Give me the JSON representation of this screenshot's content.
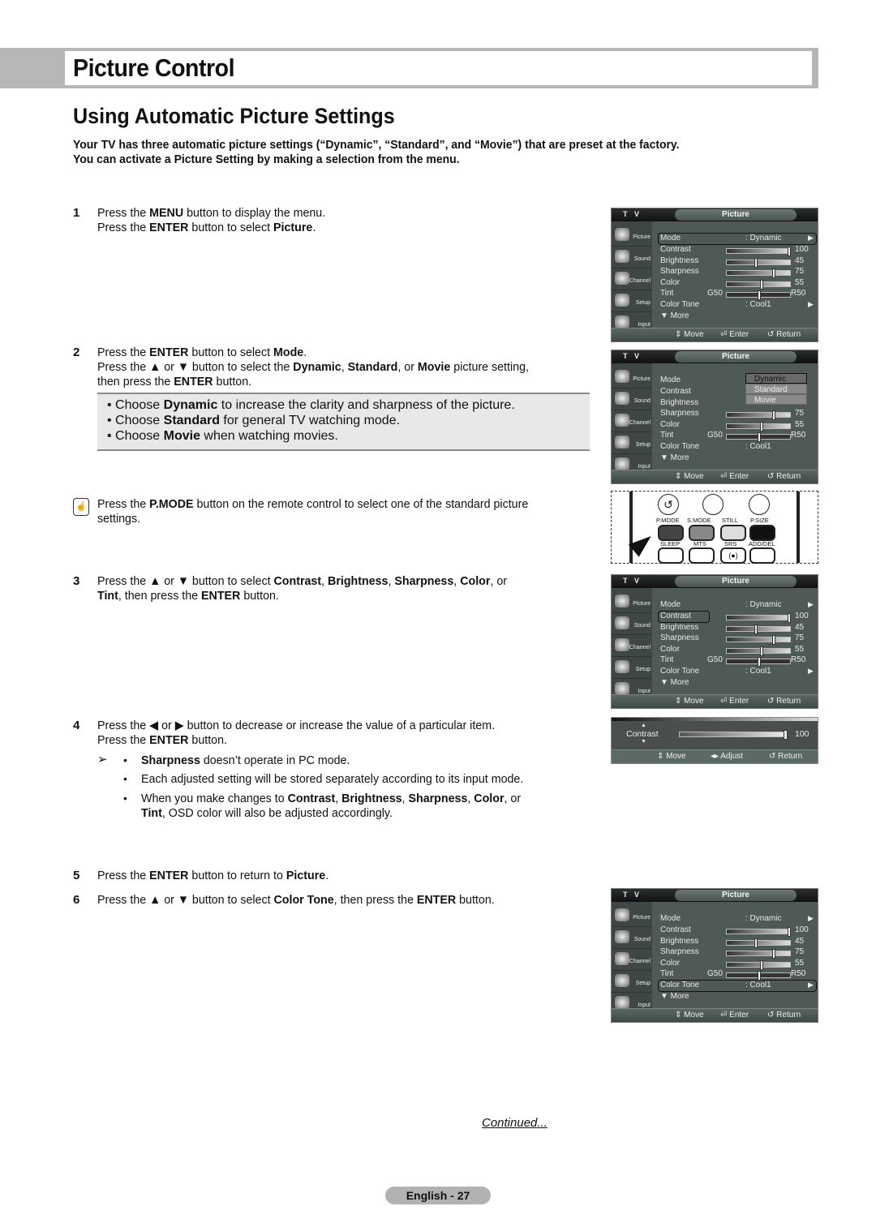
{
  "header": {
    "title": "Picture Control"
  },
  "section": {
    "title": "Using Automatic Picture Settings",
    "intro": [
      "Your TV has three automatic picture settings (“Dynamic”, “Standard”, and “Movie”) that are preset at the factory.",
      "You can activate a Picture Setting by making a selection from the menu."
    ]
  },
  "steps": [
    {
      "num": "1",
      "lines": [
        "Press the <b>MENU</b> button to display the menu.",
        "Press the <b>ENTER</b> button to select <b>Picture</b>."
      ]
    },
    {
      "num": "2",
      "lines": [
        "Press the <b>ENTER</b> button to select <b>Mode</b>.",
        "Press the ▲ or ▼ button to select the <b>Dynamic</b>, <b>Standard</b>, or <b>Movie</b> picture setting,",
        "then press the <b>ENTER</b> button."
      ]
    },
    {
      "num": "3",
      "lines": [
        "Press the ▲ or ▼ button to select <b>Contrast</b>, <b>Brightness</b>, <b>Sharpness</b>, <b>Color</b>, or",
        "<b>Tint</b>, then press the <b>ENTER</b> button."
      ]
    },
    {
      "num": "4",
      "lines": [
        "Press the ◀ or ▶ button to decrease or increase the value of a particular item.",
        "Press the <b>ENTER</b> button."
      ]
    },
    {
      "num": "5",
      "lines": [
        "Press the <b>ENTER</b> button to return to <b>Picture</b>."
      ]
    },
    {
      "num": "6",
      "lines": [
        "Press the ▲ or ▼ button to select <b>Color Tone</b>, then press the <b>ENTER</b> button."
      ]
    }
  ],
  "mode_bullets": [
    "• Choose <b>Dynamic</b> to increase the clarity and sharpness of the picture.",
    "• Choose <b>Standard</b> for general TV watching mode.",
    "• Choose <b>Movie</b> when watching movies."
  ],
  "pmode_note": [
    "Press the <b>P.MODE</b> button on the remote control to select one of the standard picture",
    "settings."
  ],
  "step4_notes": [
    [
      "<b>Sharpness</b> doesn’t operate in PC mode."
    ],
    [
      "Each adjusted setting will be stored separately according to its input mode."
    ],
    [
      "When you make changes to <b>Contrast</b>, <b>Brightness</b>, <b>Sharpness</b>, <b>Color</b>, or",
      "<b>Tint</b>, OSD color will also be adjusted accordingly."
    ]
  ],
  "note_arrow": "➢",
  "note_bullet": "•",
  "osd": {
    "tv_label": "T V",
    "tab_title": "Picture",
    "sidebar": [
      "Picture",
      "Sound",
      "Channel",
      "Setup",
      "Input"
    ],
    "mode_label": "Mode",
    "mode_value": ": Dynamic",
    "contrast_label": "Contrast",
    "contrast_value": "100",
    "contrast_level": 100,
    "brightness_label": "Brightness",
    "brightness_value": "45",
    "brightness_level": 45,
    "sharpness_label": "Sharpness",
    "sharpness_value": "75",
    "sharpness_level": 75,
    "color_label": "Color",
    "color_value": "55",
    "color_level": 55,
    "tint_label": "Tint",
    "tint_left": "G50",
    "tint_right": "R50",
    "tint_level": 50,
    "colortone_label": "Color Tone",
    "colortone_value": ": Cool1",
    "more_label": "▼  More",
    "foot_move": "⇕ Move",
    "foot_enter": "⏎ Enter",
    "foot_return": "↺ Return",
    "mode_options": [
      "Dynamic",
      "Standard",
      "Movie"
    ]
  },
  "remote": {
    "row1_labels": [
      "P.MODE",
      "S.MODE",
      "STILL",
      "P.SIZE"
    ],
    "row2_labels": [
      "SLEEP",
      "MTS",
      "SRS",
      "ADD/DEL"
    ],
    "srs_glyph": "(●)",
    "return_glyph": "↺"
  },
  "adjust": {
    "label": "Contrast",
    "value": "100",
    "level": 100,
    "foot_move": "⇕ Move",
    "foot_adjust": "◂▸ Adjust",
    "foot_return": "↺ Return"
  },
  "continued": "Continued...",
  "page_label": "English - 27"
}
